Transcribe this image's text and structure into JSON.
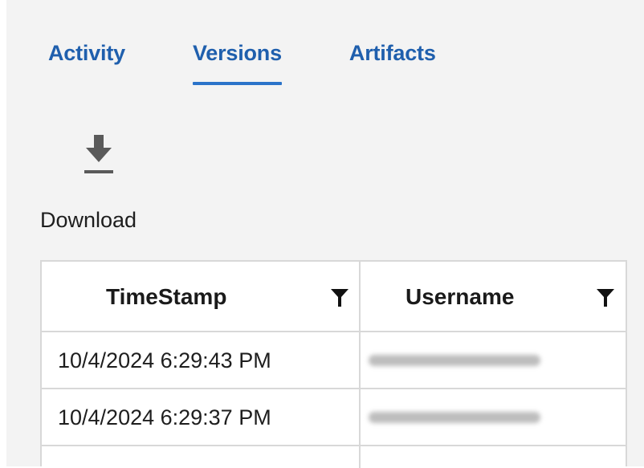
{
  "tabs": [
    {
      "label": "Activity",
      "active": false
    },
    {
      "label": "Versions",
      "active": true
    },
    {
      "label": "Artifacts",
      "active": false
    }
  ],
  "toolbar": {
    "download_label": "Download",
    "download_icon": "download-icon"
  },
  "grid": {
    "columns": [
      {
        "label": "TimeStamp",
        "filter_icon": "filter-icon"
      },
      {
        "label": "Username",
        "filter_icon": "filter-icon"
      }
    ],
    "rows": [
      {
        "timestamp": "10/4/2024 6:29:43 PM",
        "username": ""
      },
      {
        "timestamp": "10/4/2024 6:29:37 PM",
        "username": ""
      }
    ]
  },
  "colors": {
    "tab_text": "#1f5fad",
    "tab_underline": "#2b73c9",
    "panel_background": "#f3f3f3",
    "grid_border": "#d8d8d8"
  }
}
